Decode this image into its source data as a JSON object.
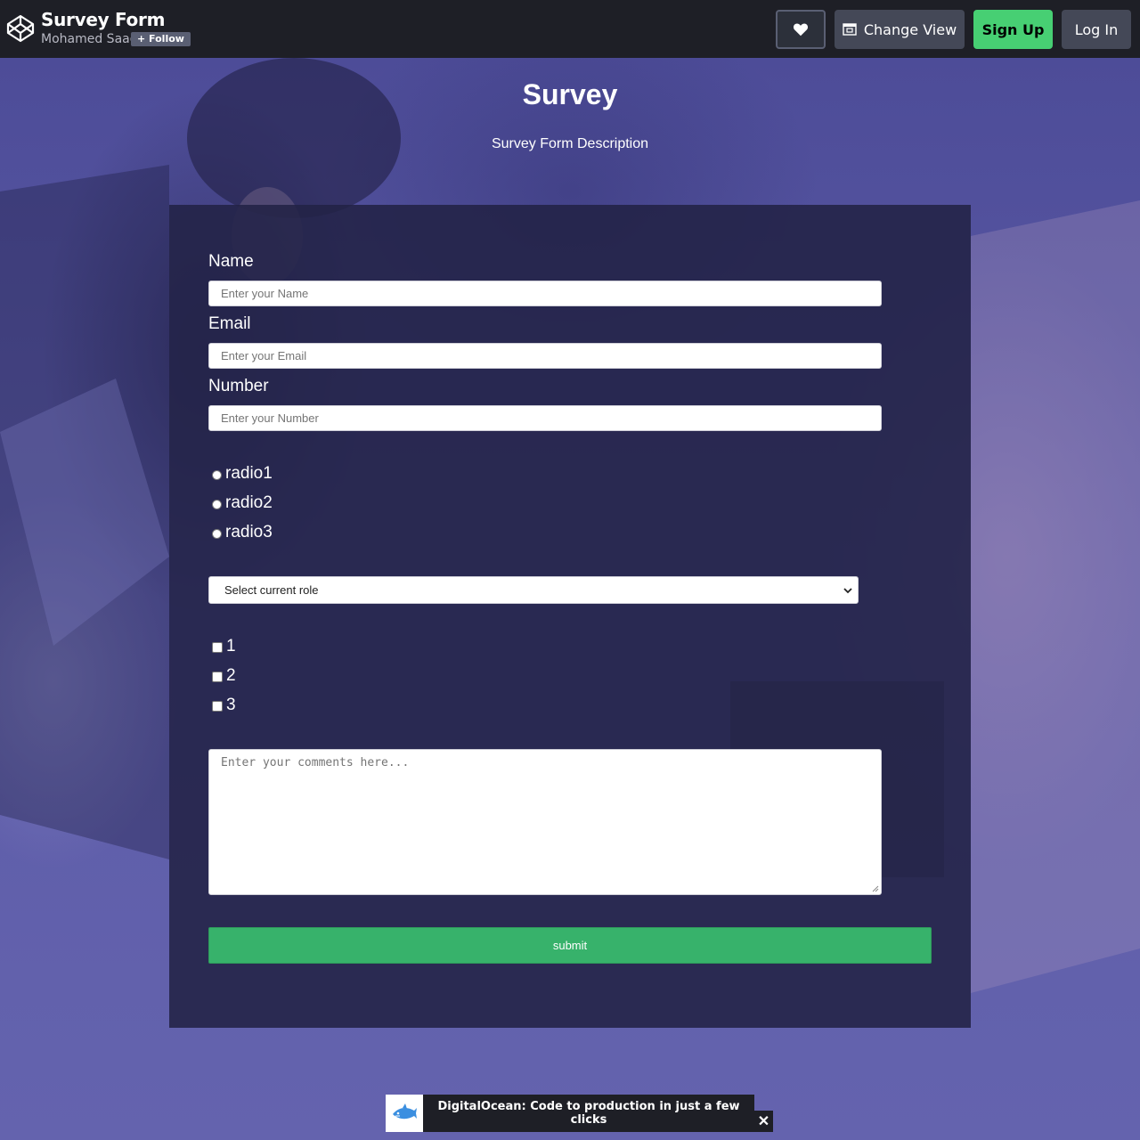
{
  "header": {
    "pen_title": "Survey Form",
    "author": "Mohamed Saad",
    "follow_label": "+ Follow",
    "change_view_label": "Change View",
    "signup_label": "Sign Up",
    "login_label": "Log In"
  },
  "page": {
    "title": "Survey",
    "description": "Survey Form Description"
  },
  "form": {
    "name_label": "Name",
    "name_placeholder": "Enter your Name",
    "email_label": "Email",
    "email_placeholder": "Enter your Email",
    "number_label": "Number",
    "number_placeholder": "Enter your Number",
    "radios": [
      "radio1",
      "radio2",
      "radio3"
    ],
    "select_value": "Select current role",
    "checkboxes": [
      "1",
      "2",
      "3"
    ],
    "comments_placeholder": "Enter your comments here...",
    "submit_label": "submit"
  },
  "ad": {
    "text": "DigitalOcean: Code to production in just a few clicks",
    "close_label": "✕"
  },
  "colors": {
    "topbar": "#1e1f26",
    "signup": "#47cf73",
    "submit": "#37b26b",
    "card": "#222246",
    "background": "#5b5aa3"
  }
}
